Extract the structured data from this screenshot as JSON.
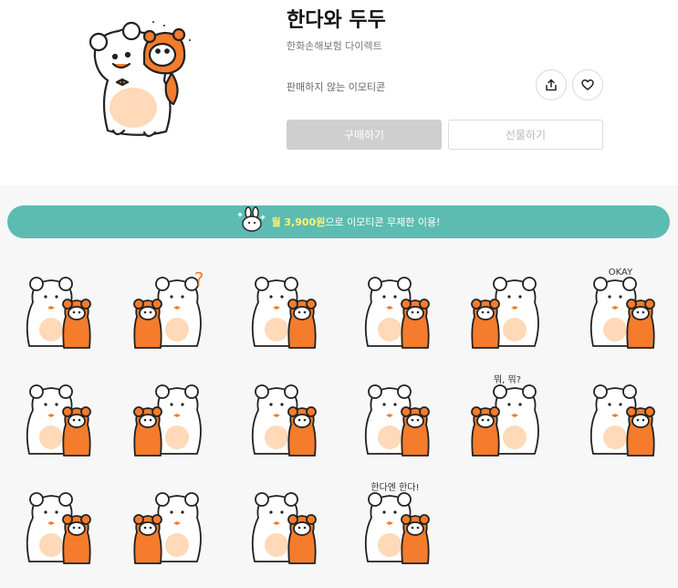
{
  "product": {
    "title": "한다와 두두",
    "author": "한화손해보험 다이렉트",
    "notice": "판매하지 않는 이모티콘",
    "buy_label": "구매하기",
    "gift_label": "선물하기"
  },
  "banner": {
    "highlight": "월 3,900원",
    "rest": "으로 이모티콘 무제한 이용!"
  },
  "stickers": [
    {
      "caption": ""
    },
    {
      "caption": "?"
    },
    {
      "caption": ""
    },
    {
      "caption": ""
    },
    {
      "caption": ""
    },
    {
      "caption": "OKAY"
    },
    {
      "caption": ""
    },
    {
      "caption": ""
    },
    {
      "caption": ""
    },
    {
      "caption": ""
    },
    {
      "caption": "뭐, 뭐?"
    },
    {
      "caption": ""
    },
    {
      "caption": ""
    },
    {
      "caption": ""
    },
    {
      "caption": ""
    },
    {
      "caption": "한다엔 한다!"
    }
  ],
  "colors": {
    "accent_teal": "#5cbcb2",
    "highlight_yellow": "#fff36b",
    "tiger_orange": "#f47c2c",
    "belly_peach": "#ffd9b8"
  }
}
